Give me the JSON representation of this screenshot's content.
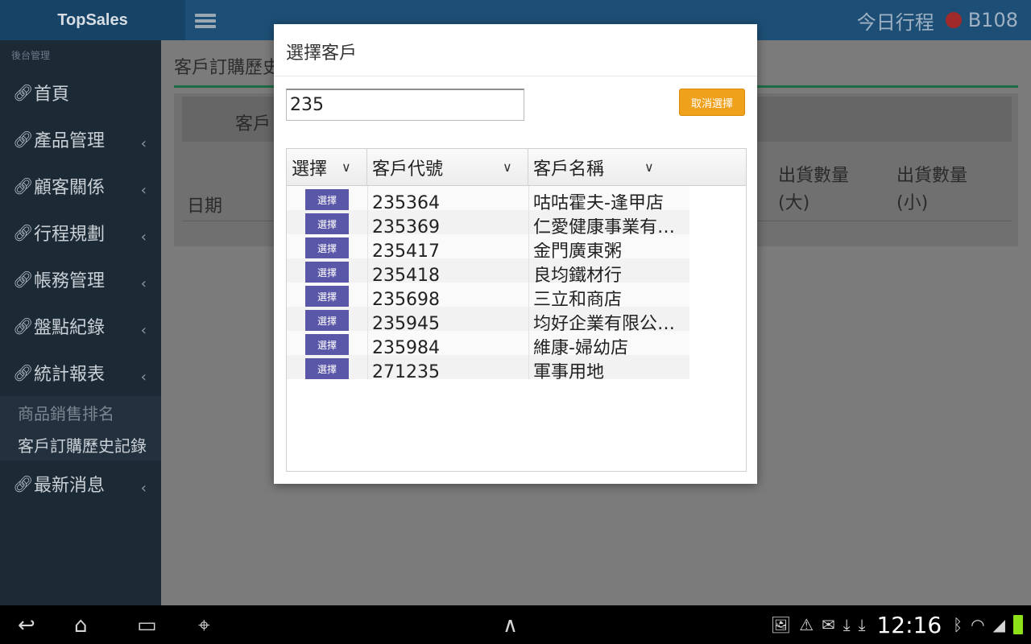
{
  "app": {
    "brand": "TopSales",
    "today_schedule": "今日行程",
    "user": "B108"
  },
  "sidebar": {
    "section": "後台管理",
    "items": [
      {
        "label": "首頁"
      },
      {
        "label": "產品管理"
      },
      {
        "label": "顧客關係"
      },
      {
        "label": "行程規劃"
      },
      {
        "label": "帳務管理"
      },
      {
        "label": "盤點紀錄"
      },
      {
        "label": "統計報表"
      }
    ],
    "subitems": [
      {
        "label": "商品銷售排名"
      },
      {
        "label": "客戶訂購歷史記錄"
      }
    ],
    "last_item": {
      "label": "最新消息"
    }
  },
  "main": {
    "title": "客戶訂購歷史",
    "header_label": "客戶",
    "col_date": "日期",
    "col_qty_big": [
      "出貨數量",
      "(大)"
    ],
    "col_qty_small": [
      "出貨數量",
      "(小)"
    ]
  },
  "modal": {
    "title": "選擇客戶",
    "search_value": "235",
    "cancel_label": "取消選擇",
    "columns": [
      "選擇",
      "客戶代號",
      "客戶名稱"
    ],
    "select_label": "選擇",
    "rows": [
      {
        "code": "235364",
        "name": "咕咕霍夫-逢甲店"
      },
      {
        "code": "235369",
        "name": "仁愛健康事業有…"
      },
      {
        "code": "235417",
        "name": "金門廣東粥"
      },
      {
        "code": "235418",
        "name": "良均鐵材行"
      },
      {
        "code": "235698",
        "name": "三立和商店"
      },
      {
        "code": "235945",
        "name": "均好企業有限公…"
      },
      {
        "code": "235984",
        "name": "維康-婦幼店"
      },
      {
        "code": "271235",
        "name": "軍事用地"
      }
    ]
  },
  "statusbar": {
    "time": "12:16"
  },
  "colors": {
    "accent": "#f0a11c",
    "select_button": "#5a56a8",
    "topbar": "#1d4f76"
  }
}
